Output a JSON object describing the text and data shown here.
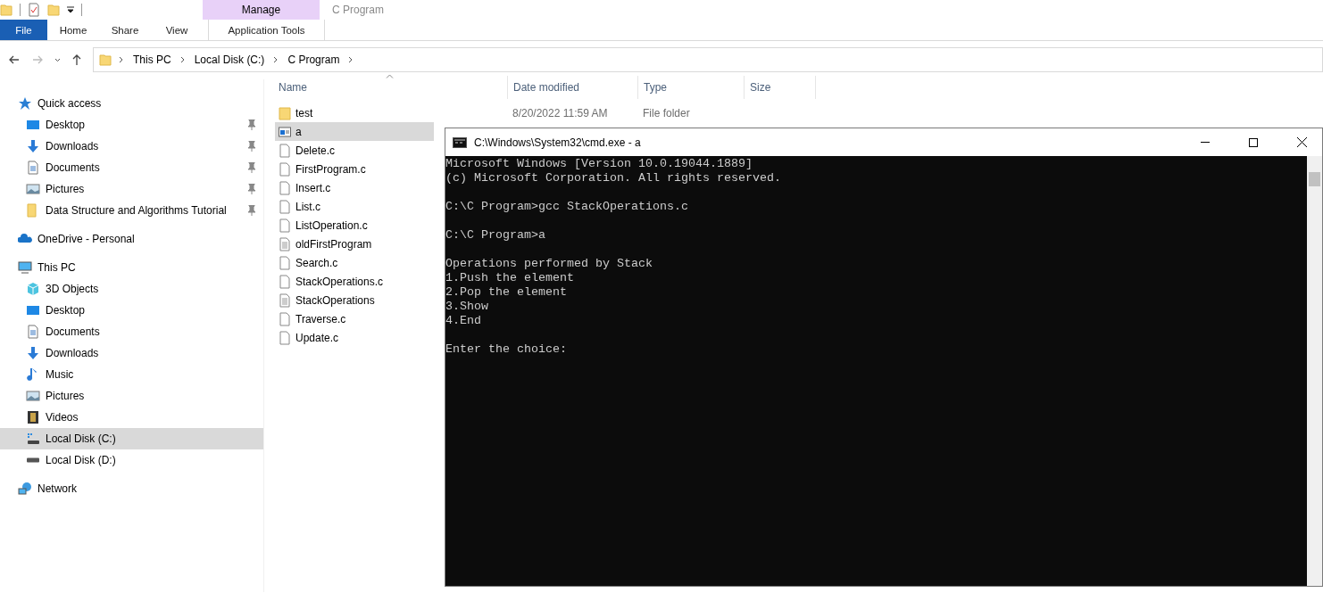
{
  "window": {
    "title": "C Program"
  },
  "ribbon": {
    "context_group": "Manage",
    "tabs": [
      {
        "label": "File",
        "kind": "file"
      },
      {
        "label": "Home",
        "kind": "plain"
      },
      {
        "label": "Share",
        "kind": "plain"
      },
      {
        "label": "View",
        "kind": "plain"
      },
      {
        "label": "Application Tools",
        "kind": "context"
      }
    ]
  },
  "address": {
    "crumbs": [
      "This PC",
      "Local Disk (C:)",
      "C Program"
    ]
  },
  "sidebar": {
    "items": [
      {
        "label": "Quick access",
        "kind": "star",
        "selected": false,
        "children": [
          {
            "label": "Desktop",
            "kind": "desktop",
            "pinned": true,
            "selected": false
          },
          {
            "label": "Downloads",
            "kind": "download",
            "pinned": true,
            "selected": false
          },
          {
            "label": "Documents",
            "kind": "document",
            "pinned": true,
            "selected": false
          },
          {
            "label": "Pictures",
            "kind": "picture",
            "pinned": true,
            "selected": false
          },
          {
            "label": "Data Structure and Algorithms Tutorial",
            "kind": "folder",
            "pinned": true,
            "selected": false
          }
        ]
      },
      {
        "label": "OneDrive - Personal",
        "kind": "cloud",
        "selected": false
      },
      {
        "label": "This PC",
        "kind": "pc",
        "selected": false,
        "children": [
          {
            "label": "3D Objects",
            "kind": "cube",
            "pinned": false,
            "selected": false
          },
          {
            "label": "Desktop",
            "kind": "desktop",
            "pinned": false,
            "selected": false
          },
          {
            "label": "Documents",
            "kind": "document",
            "pinned": false,
            "selected": false
          },
          {
            "label": "Downloads",
            "kind": "download",
            "pinned": false,
            "selected": false
          },
          {
            "label": "Music",
            "kind": "music",
            "pinned": false,
            "selected": false
          },
          {
            "label": "Pictures",
            "kind": "picture",
            "pinned": false,
            "selected": false
          },
          {
            "label": "Videos",
            "kind": "video",
            "pinned": false,
            "selected": false
          },
          {
            "label": "Local Disk (C:)",
            "kind": "sysdisk",
            "pinned": false,
            "selected": true
          },
          {
            "label": "Local Disk (D:)",
            "kind": "disk",
            "pinned": false,
            "selected": false
          }
        ]
      },
      {
        "label": "Network",
        "kind": "network",
        "selected": false
      }
    ]
  },
  "files": {
    "columns": [
      "Name",
      "Date modified",
      "Type",
      "Size"
    ],
    "rows": [
      {
        "name": "test",
        "kind": "folder",
        "date": "8/20/2022 11:59 AM",
        "type": "File folder",
        "selected": false
      },
      {
        "name": "a",
        "kind": "app",
        "selected": true
      },
      {
        "name": "Delete.c",
        "kind": "file",
        "selected": false
      },
      {
        "name": "FirstProgram.c",
        "kind": "file",
        "selected": false
      },
      {
        "name": "Insert.c",
        "kind": "file",
        "selected": false
      },
      {
        "name": "List.c",
        "kind": "file",
        "selected": false
      },
      {
        "name": "ListOperation.c",
        "kind": "file",
        "selected": false
      },
      {
        "name": "oldFirstProgram",
        "kind": "text",
        "selected": false
      },
      {
        "name": "Search.c",
        "kind": "file",
        "selected": false
      },
      {
        "name": "StackOperations.c",
        "kind": "file",
        "selected": false
      },
      {
        "name": "StackOperations",
        "kind": "text",
        "selected": false
      },
      {
        "name": "Traverse.c",
        "kind": "file",
        "selected": false
      },
      {
        "name": "Update.c",
        "kind": "file",
        "selected": false
      }
    ]
  },
  "console": {
    "title": "C:\\Windows\\System32\\cmd.exe - a",
    "blocks": [
      [
        "Microsoft Windows [Version 10.0.19044.1889]",
        "(c) Microsoft Corporation. All rights reserved."
      ],
      [
        "C:\\C Program>gcc StackOperations.c"
      ],
      [
        "C:\\C Program>a"
      ],
      [
        "Operations performed by Stack",
        "1.Push the element",
        "2.Pop the element",
        "3.Show",
        "4.End"
      ],
      [
        "Enter the choice:"
      ]
    ]
  }
}
